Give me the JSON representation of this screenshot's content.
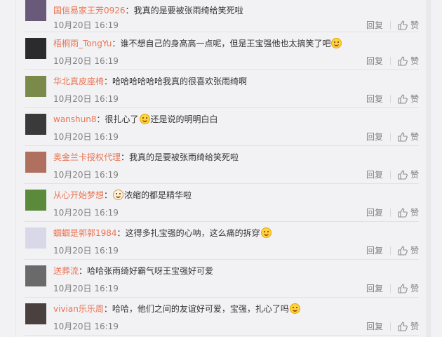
{
  "comments": [
    {
      "user": "国信易家王芳0926",
      "sep": "：",
      "parts": [
        {
          "text": "我真的是要被张雨绮给笑死啦"
        }
      ],
      "time": "10月20日 16:19",
      "avatar_color": "#6a5a7a"
    },
    {
      "user": "梧桐雨_TongYu",
      "sep": "：",
      "parts": [
        {
          "text": "谁不想自己的身高高一点呢，但是王宝强他也太搞笑了吧"
        },
        {
          "emoji": "laugh-cry-emoji"
        }
      ],
      "time": "10月20日 16:19",
      "avatar_color": "#2b2b2b"
    },
    {
      "user": "华北真皮座椅",
      "sep": "：",
      "parts": [
        {
          "text": "哈哈哈哈哈哈我真的很喜欢张雨绮啊"
        }
      ],
      "time": "10月20日 16:19",
      "avatar_color": "#7a8a4a"
    },
    {
      "user": "wanshun8",
      "sep": "：",
      "parts": [
        {
          "text": "很扎心了"
        },
        {
          "emoji": "laugh-cry-emoji"
        },
        {
          "text": "还是说的明明白白"
        }
      ],
      "time": "10月20日 16:19",
      "avatar_color": "#3a3a3a"
    },
    {
      "user": "奥金兰卡授权代理",
      "sep": "：",
      "parts": [
        {
          "text": "我真的是要被张雨绮给笑死啦"
        }
      ],
      "time": "10月20日 16:19",
      "avatar_color": "#b07060"
    },
    {
      "user": "从心开始梦想",
      "sep": "：",
      "parts": [
        {
          "emoji": "bear-emoji"
        },
        {
          "text": "浓缩的都是精华啦"
        }
      ],
      "time": "10月20日 16:19",
      "avatar_color": "#5a8a3a"
    },
    {
      "user": "蝈蝈是郭郭1984",
      "sep": "：",
      "parts": [
        {
          "text": "这得多扎宝强的心呐，这么痛的拆穿"
        },
        {
          "emoji": "laugh-cry-emoji"
        }
      ],
      "time": "10月20日 16:19",
      "avatar_color": "#d8d8e8"
    },
    {
      "user": "送葬流",
      "sep": "：",
      "parts": [
        {
          "text": "哈哈张雨绮好霸气呀王宝强好可爱"
        }
      ],
      "time": "10月20日 16:19",
      "avatar_color": "#6a6a6a"
    },
    {
      "user": "vivian乐乐周",
      "sep": "：",
      "parts": [
        {
          "text": "哈哈，他们之间的友谊好可爱，宝强，扎心了吗"
        },
        {
          "emoji": "shy-emoji"
        }
      ],
      "time": "10月20日 16:19",
      "avatar_color": "#4a4040"
    }
  ],
  "actions": {
    "reply_label": "回复",
    "like_label": "赞"
  }
}
